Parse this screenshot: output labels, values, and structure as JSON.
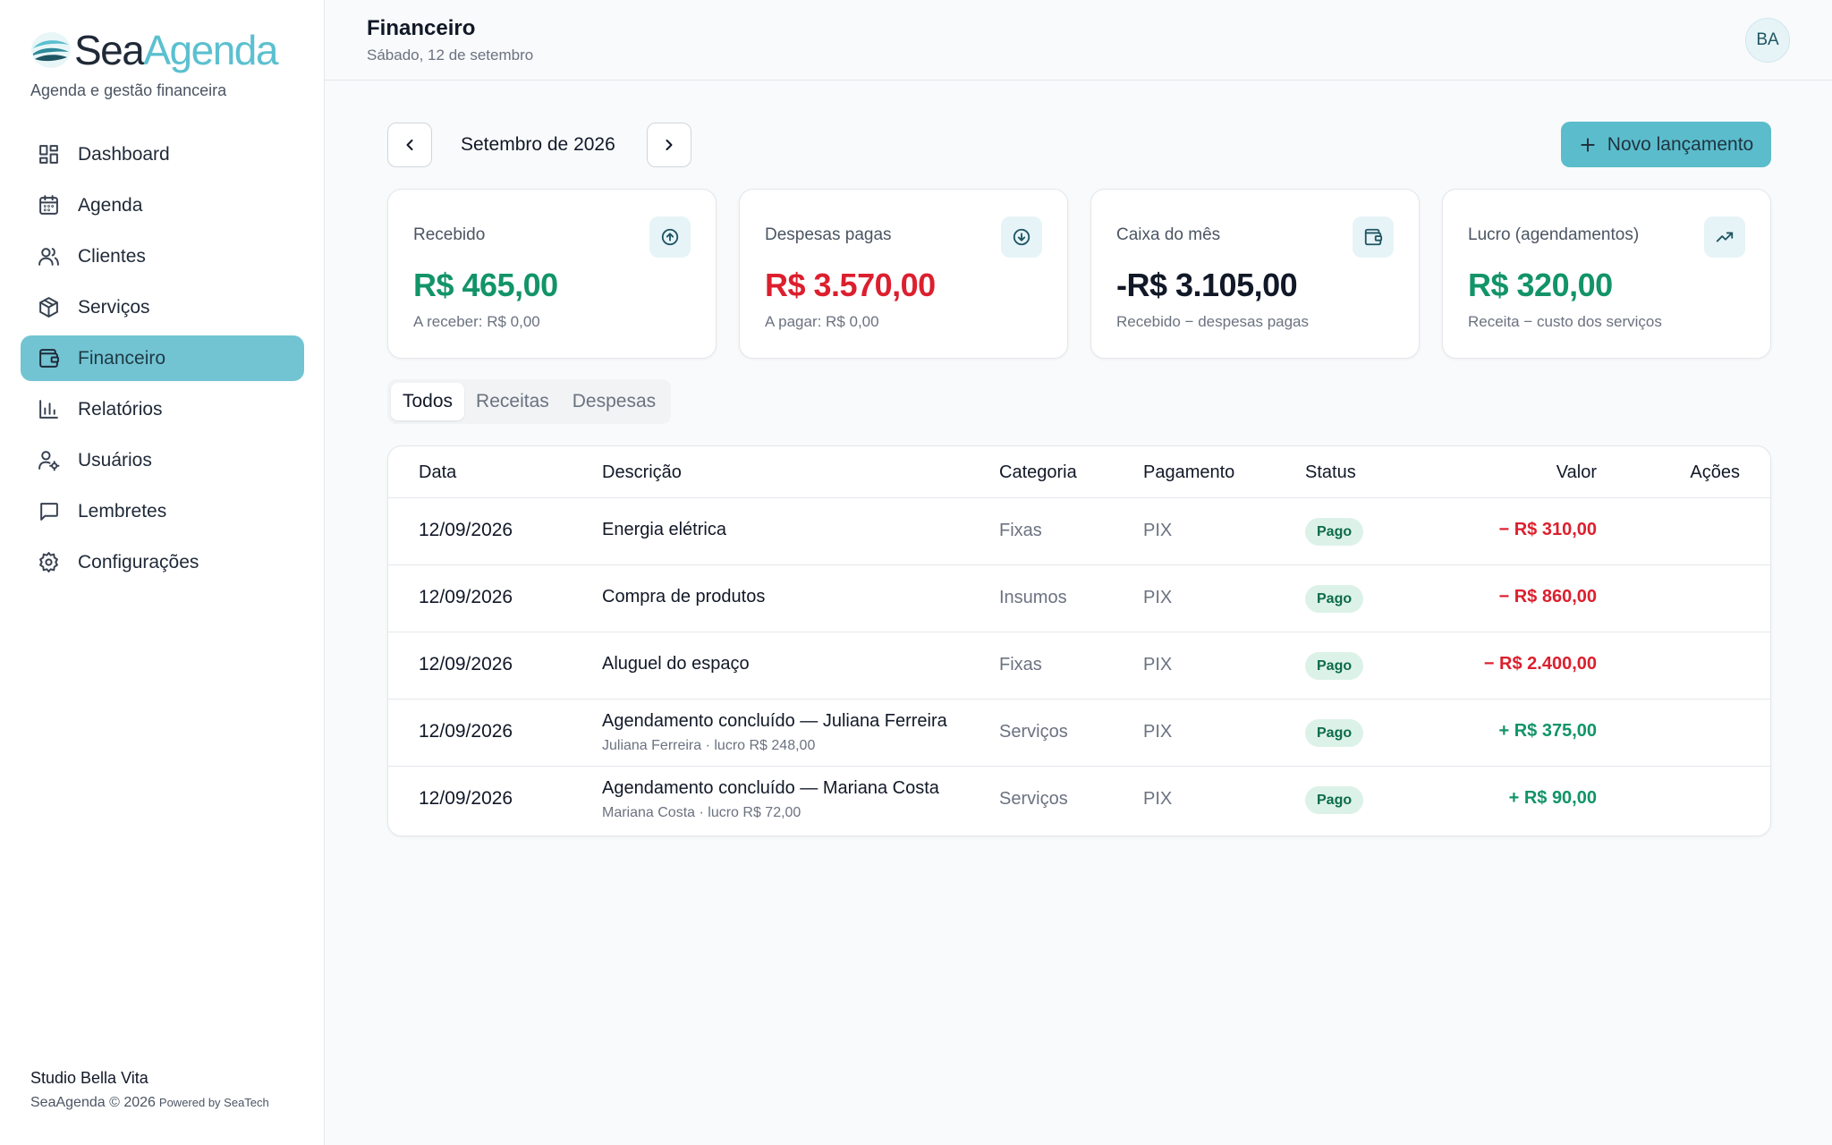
{
  "brand": {
    "sea": "Sea",
    "agenda": "Agenda",
    "tagline": "Agenda e gestão financeira"
  },
  "nav": [
    {
      "label": "Dashboard",
      "icon": "dashboard-icon"
    },
    {
      "label": "Agenda",
      "icon": "calendar-icon"
    },
    {
      "label": "Clientes",
      "icon": "users-icon"
    },
    {
      "label": "Serviços",
      "icon": "box-icon"
    },
    {
      "label": "Financeiro",
      "icon": "wallet-icon",
      "active": true
    },
    {
      "label": "Relatórios",
      "icon": "bar-chart-icon"
    },
    {
      "label": "Usuários",
      "icon": "user-gear-icon"
    },
    {
      "label": "Lembretes",
      "icon": "message-icon"
    },
    {
      "label": "Configurações",
      "icon": "gear-icon"
    }
  ],
  "footer": {
    "studio": "Studio Bella Vita",
    "copyright": "SeaAgenda © 2026",
    "powered": "Powered by SeaTech"
  },
  "header": {
    "title": "Financeiro",
    "date": "Sábado, 12 de setembro",
    "avatar": "BA"
  },
  "month": {
    "label": "Setembro de 2026"
  },
  "new_button": "Novo lançamento",
  "cards": [
    {
      "label": "Recebido",
      "value": "R$ 465,00",
      "sub": "A receber: R$ 0,00",
      "tone": "green",
      "icon": "arrow-up-circle-icon"
    },
    {
      "label": "Despesas pagas",
      "value": "R$ 3.570,00",
      "sub": "A pagar: R$ 0,00",
      "tone": "red",
      "icon": "arrow-down-circle-icon"
    },
    {
      "label": "Caixa do mês",
      "value": "-R$ 3.105,00",
      "sub": "Recebido − despesas pagas",
      "tone": "dark",
      "icon": "wallet-icon"
    },
    {
      "label": "Lucro (agendamentos)",
      "value": "R$ 320,00",
      "sub": "Receita − custo dos serviços",
      "tone": "green",
      "icon": "trending-up-icon"
    }
  ],
  "tabs": [
    "Todos",
    "Receitas",
    "Despesas"
  ],
  "table": {
    "headers": {
      "date": "Data",
      "desc": "Descrição",
      "cat": "Categoria",
      "pay": "Pagamento",
      "status": "Status",
      "value": "Valor",
      "actions": "Ações"
    },
    "rows": [
      {
        "date": "12/09/2026",
        "desc": "Energia elétrica",
        "sub": "",
        "cat": "Fixas",
        "pay": "PIX",
        "status": "Pago",
        "value": "− R$ 310,00",
        "type": "expense"
      },
      {
        "date": "12/09/2026",
        "desc": "Compra de produtos",
        "sub": "",
        "cat": "Insumos",
        "pay": "PIX",
        "status": "Pago",
        "value": "− R$ 860,00",
        "type": "expense"
      },
      {
        "date": "12/09/2026",
        "desc": "Aluguel do espaço",
        "sub": "",
        "cat": "Fixas",
        "pay": "PIX",
        "status": "Pago",
        "value": "− R$ 2.400,00",
        "type": "expense"
      },
      {
        "date": "12/09/2026",
        "desc": "Agendamento concluído — Juliana Ferreira",
        "sub": "Juliana Ferreira · lucro R$ 248,00",
        "cat": "Serviços",
        "pay": "PIX",
        "status": "Pago",
        "value": "+ R$ 375,00",
        "type": "income"
      },
      {
        "date": "12/09/2026",
        "desc": "Agendamento concluído — Mariana Costa",
        "sub": "Mariana Costa · lucro R$ 72,00",
        "cat": "Serviços",
        "pay": "PIX",
        "status": "Pago",
        "value": "+ R$ 90,00",
        "type": "income"
      }
    ]
  },
  "colors": {
    "accent": "#5bbccc",
    "active_nav": "#72c4d3",
    "green": "#129468",
    "red": "#dc1f2e",
    "undo": "#d4880f"
  }
}
